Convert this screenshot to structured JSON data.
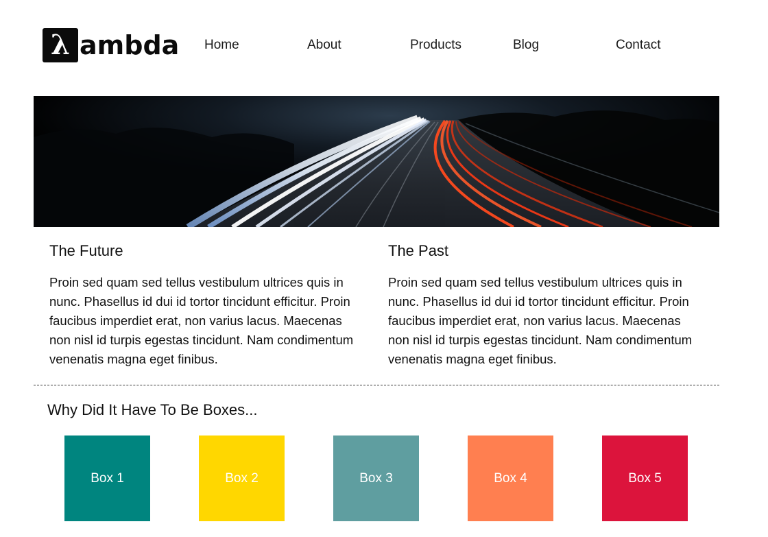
{
  "header": {
    "logo": {
      "mark": "λ",
      "text": "ambda",
      "icon": "lambda-logo-icon"
    },
    "nav": [
      {
        "label": "Home"
      },
      {
        "label": "About"
      },
      {
        "label": "Products"
      },
      {
        "label": "Blog"
      },
      {
        "label": "Contact"
      }
    ]
  },
  "hero": {
    "image": "night-highway-light-trails"
  },
  "columns": [
    {
      "title": "The Future",
      "body": "Proin sed quam sed tellus vestibulum ultrices quis in nunc. Phasellus id dui id tortor tincidunt efficitur. Proin faucibus imperdiet erat, non varius lacus. Maecenas non nisl id turpis egestas tincidunt. Nam condimentum venenatis magna eget finibus."
    },
    {
      "title": "The Past",
      "body": "Proin sed quam sed tellus vestibulum ultrices quis in nunc. Phasellus id dui id tortor tincidunt efficitur. Proin faucibus imperdiet erat, non varius lacus. Maecenas non nisl id turpis egestas tincidunt. Nam condimentum venenatis magna eget finibus."
    }
  ],
  "boxes": {
    "title": "Why Did It Have To Be Boxes...",
    "items": [
      {
        "label": "Box 1",
        "color": "#00857f"
      },
      {
        "label": "Box 2",
        "color": "#ffd700"
      },
      {
        "label": "Box 3",
        "color": "#5f9ea0"
      },
      {
        "label": "Box 4",
        "color": "#ff7f50"
      },
      {
        "label": "Box 5",
        "color": "#dc143c"
      }
    ]
  }
}
